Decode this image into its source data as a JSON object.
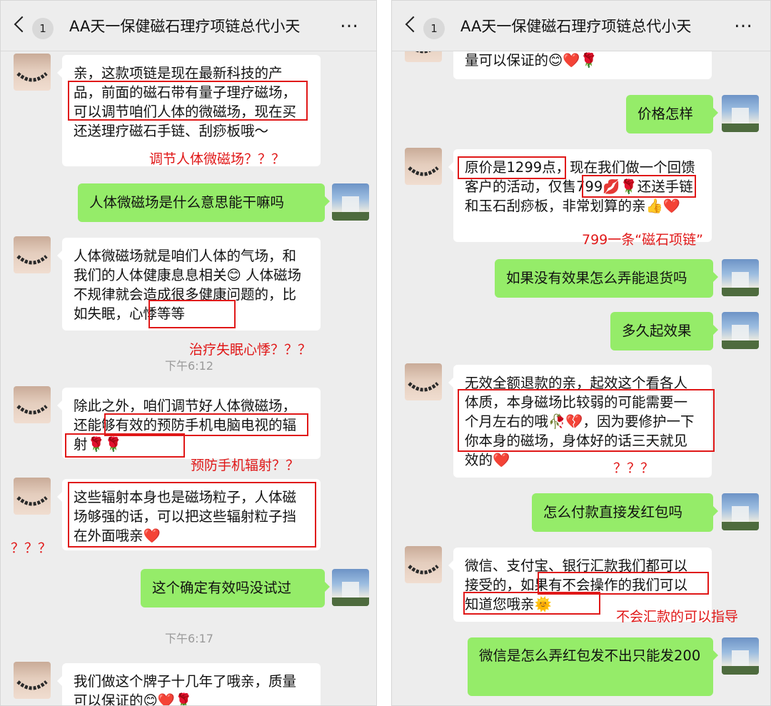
{
  "chat": {
    "badge": "1",
    "title": "AA天一保健磁石理疗项链总代小天",
    "more_icon": "…"
  },
  "left": {
    "m1": "亲，这款项链是现在最新科技的产品，前面的磁石带有量子理疗磁场，可以调节咱们人体的微磁场，现在买还送理疗磁石手链、刮痧板哦～",
    "a1": "调节人体微磁场？？？",
    "m2": "人体微磁场是什么意思能干嘛吗",
    "m3": "人体微磁场就是咱们人体的气场，和我们的人体健康息息相关😊 人体磁场不规律就会造成很多健康问题的，比如失眠，心悸等等",
    "a2": "治疗失眠心悸？？？",
    "t1": "下午6:12",
    "m4": "除此之外，咱们调节好人体微磁场，还能够有效的预防手机电脑电视的辐射🌹🌹",
    "a3": "预防手机辐射？？",
    "m5": "这些辐射本身也是磁场粒子，人体磁场够强的话，可以把这些辐射粒子挡在外面哦亲❤️",
    "a4": "？？？",
    "m6": "这个确定有效吗没试过",
    "t2": "下午6:17",
    "m7": "我们做这个牌子十几年了哦亲，质量可以保证的😊❤️🌹"
  },
  "right": {
    "m0": "量可以保证的😊❤️🌹",
    "m1": "价格怎样",
    "m2": "原价是1299点，现在我们做一个回馈客户的活动，仅售799💋🌹还送手链和玉石刮痧板，非常划算的亲👍❤️",
    "a1": "799一条“磁石项链”",
    "m3": "如果没有效果怎么弄能退货吗",
    "m4": "多久起效果",
    "m5": "无效全额退款的亲，起效这个看各人体质，本身磁场比较弱的可能需要一个月左右的哦🥀💔，因为要修护一下你本身的磁场，身体好的话三天就见效的❤️",
    "a2": "？？？",
    "m6": "怎么付款直接发红包吗",
    "m7": "微信、支付宝、银行汇款我们都可以接受的，如果有不会操作的我们可以知道您哦亲🌞",
    "a3": "不会汇款的可以指导",
    "m8": "微信是怎么弄红包发不出只能发200"
  }
}
